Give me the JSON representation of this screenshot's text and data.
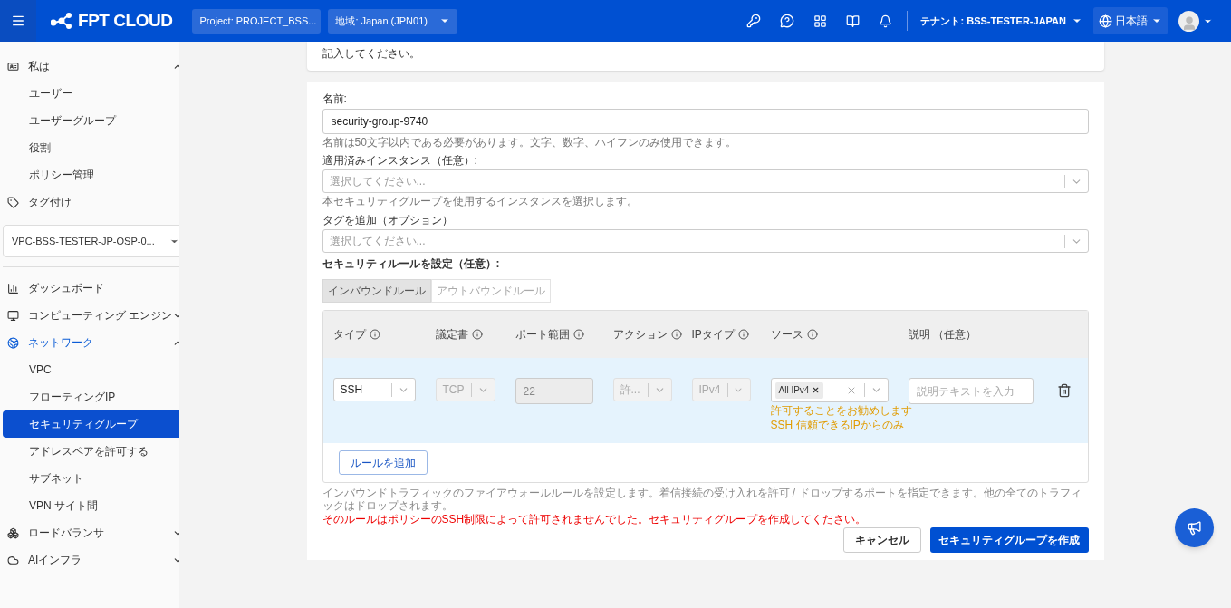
{
  "header": {
    "logo": "FPT CLOUD",
    "project": "Project: PROJECT_BSS...",
    "region": "地域: Japan (JPN01)",
    "tenant": "テナント: BSS-TESTER-JAPAN",
    "language": "日本語"
  },
  "sidebar": {
    "items": [
      {
        "label": "私は",
        "expanded": true,
        "selected": false,
        "children": [
          {
            "label": "ユーザー",
            "selected": false
          },
          {
            "label": "ユーザーグループ",
            "selected": false
          },
          {
            "label": "役割",
            "selected": false
          },
          {
            "label": "ポリシー管理",
            "selected": false
          }
        ]
      },
      {
        "label": "タグ付け",
        "selected": false
      }
    ],
    "vpc_select": "VPC-BSS-TESTER-JP-OSP-0...",
    "items2": [
      {
        "label": "ダッシュボード",
        "selected": false
      },
      {
        "label": "コンピューティング エンジン",
        "expanded": false,
        "selected": false
      },
      {
        "label": "ネットワーク",
        "expanded": true,
        "selected": true,
        "children": [
          {
            "label": "VPC",
            "selected": false
          },
          {
            "label": "フローティングIP",
            "selected": false
          },
          {
            "label": "セキュリティグループ",
            "selected": true
          },
          {
            "label": "アドレスペアを許可する",
            "selected": false
          },
          {
            "label": "サブネット",
            "selected": false
          },
          {
            "label": "VPN サイト間",
            "selected": false
          }
        ]
      },
      {
        "label": "ロードバランサ",
        "expanded": false,
        "selected": false
      },
      {
        "label": "AIインフラ",
        "expanded": false,
        "selected": false
      }
    ]
  },
  "top_card": {
    "text": "記入してください。"
  },
  "form": {
    "name": {
      "label": "名前:",
      "value": "security-group-9740",
      "hint": "名前は50文字以内である必要があります。文字、数字、ハイフンのみ使用できます。"
    },
    "instances": {
      "label": "適用済みインスタンス（任意）:",
      "placeholder": "選択してください...",
      "hint": "本セキュリティグループを使用するインスタンスを選択します。"
    },
    "tags": {
      "label": "タグを追加（オプション）",
      "placeholder": "選択してください..."
    },
    "rules_label": "セキュリティルールを設定（任意）:",
    "tabs": [
      {
        "label": "インバウンドルール",
        "selected": true
      },
      {
        "label": "アウトバウンドルール",
        "selected": false
      }
    ],
    "table": {
      "columns": [
        {
          "label": "タイプ",
          "info": true
        },
        {
          "label": "議定書",
          "info": true
        },
        {
          "label": "ポート範囲",
          "info": true
        },
        {
          "label": "アクション",
          "info": true
        },
        {
          "label": "IPタイプ",
          "info": true
        },
        {
          "label": "ソース",
          "info": true
        },
        {
          "label": "説明 （任意）",
          "info": false
        }
      ],
      "rows": [
        {
          "cells": [
            {
              "kind": "select",
              "value": "SSH",
              "disabled": false
            },
            {
              "kind": "select",
              "value": "TCP",
              "disabled": true
            },
            {
              "kind": "input",
              "value": "22",
              "disabled": true
            },
            {
              "kind": "select",
              "value": "許...",
              "disabled": true
            },
            {
              "kind": "select",
              "value": "IPv4",
              "disabled": true
            },
            {
              "kind": "multi",
              "tags": [
                "All IPv4"
              ],
              "notes": [
                "許可することをお勧めします",
                "SSH 信頼できるIPからのみ"
              ],
              "disabled": false
            },
            {
              "kind": "input",
              "placeholder": "説明テキストを入力",
              "disabled": false
            }
          ]
        }
      ],
      "add_button": "ルールを追加"
    },
    "help": "インバウンドトラフィックのファイアウォールルールを設定します。着信接続の受け入れを許可 / ドロップするポートを指定できます。他の全てのトラフィックはドロップされます。",
    "error": "そのルールはポリシーのSSH制限によって許可されませんでした。セキュリティグループを作成してください。",
    "cancel": "キャンセル",
    "submit": "セキュリティグループを作成"
  }
}
